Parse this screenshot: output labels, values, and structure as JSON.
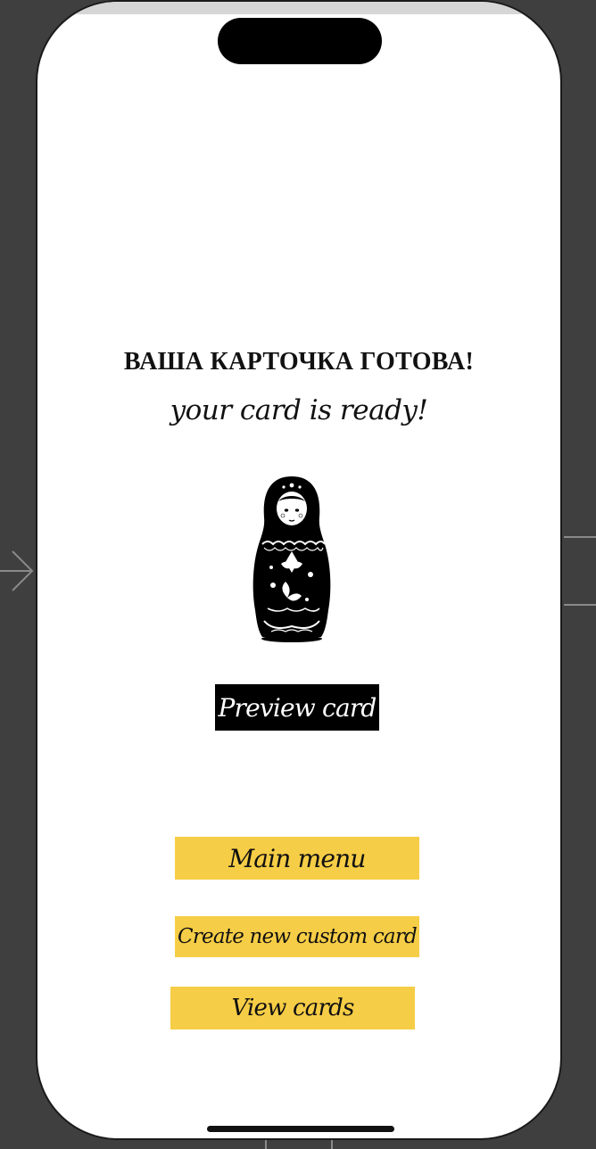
{
  "colors": {
    "canvas_background": "#3f3f3f",
    "screen_background": "#ffffff",
    "primary_button": "#000000",
    "accent_yellow": "#f6cd46",
    "text": "#111111"
  },
  "screen": {
    "heading_ru": "ВАША КАРТОЧКА ГОТОВА!",
    "heading_en": "your card is ready!",
    "illustration_icon": "matryoshka-doll-icon"
  },
  "buttons": {
    "preview": "Preview card",
    "main_menu": "Main menu",
    "create_new": "Create new custom card",
    "view_cards": "View cards"
  }
}
